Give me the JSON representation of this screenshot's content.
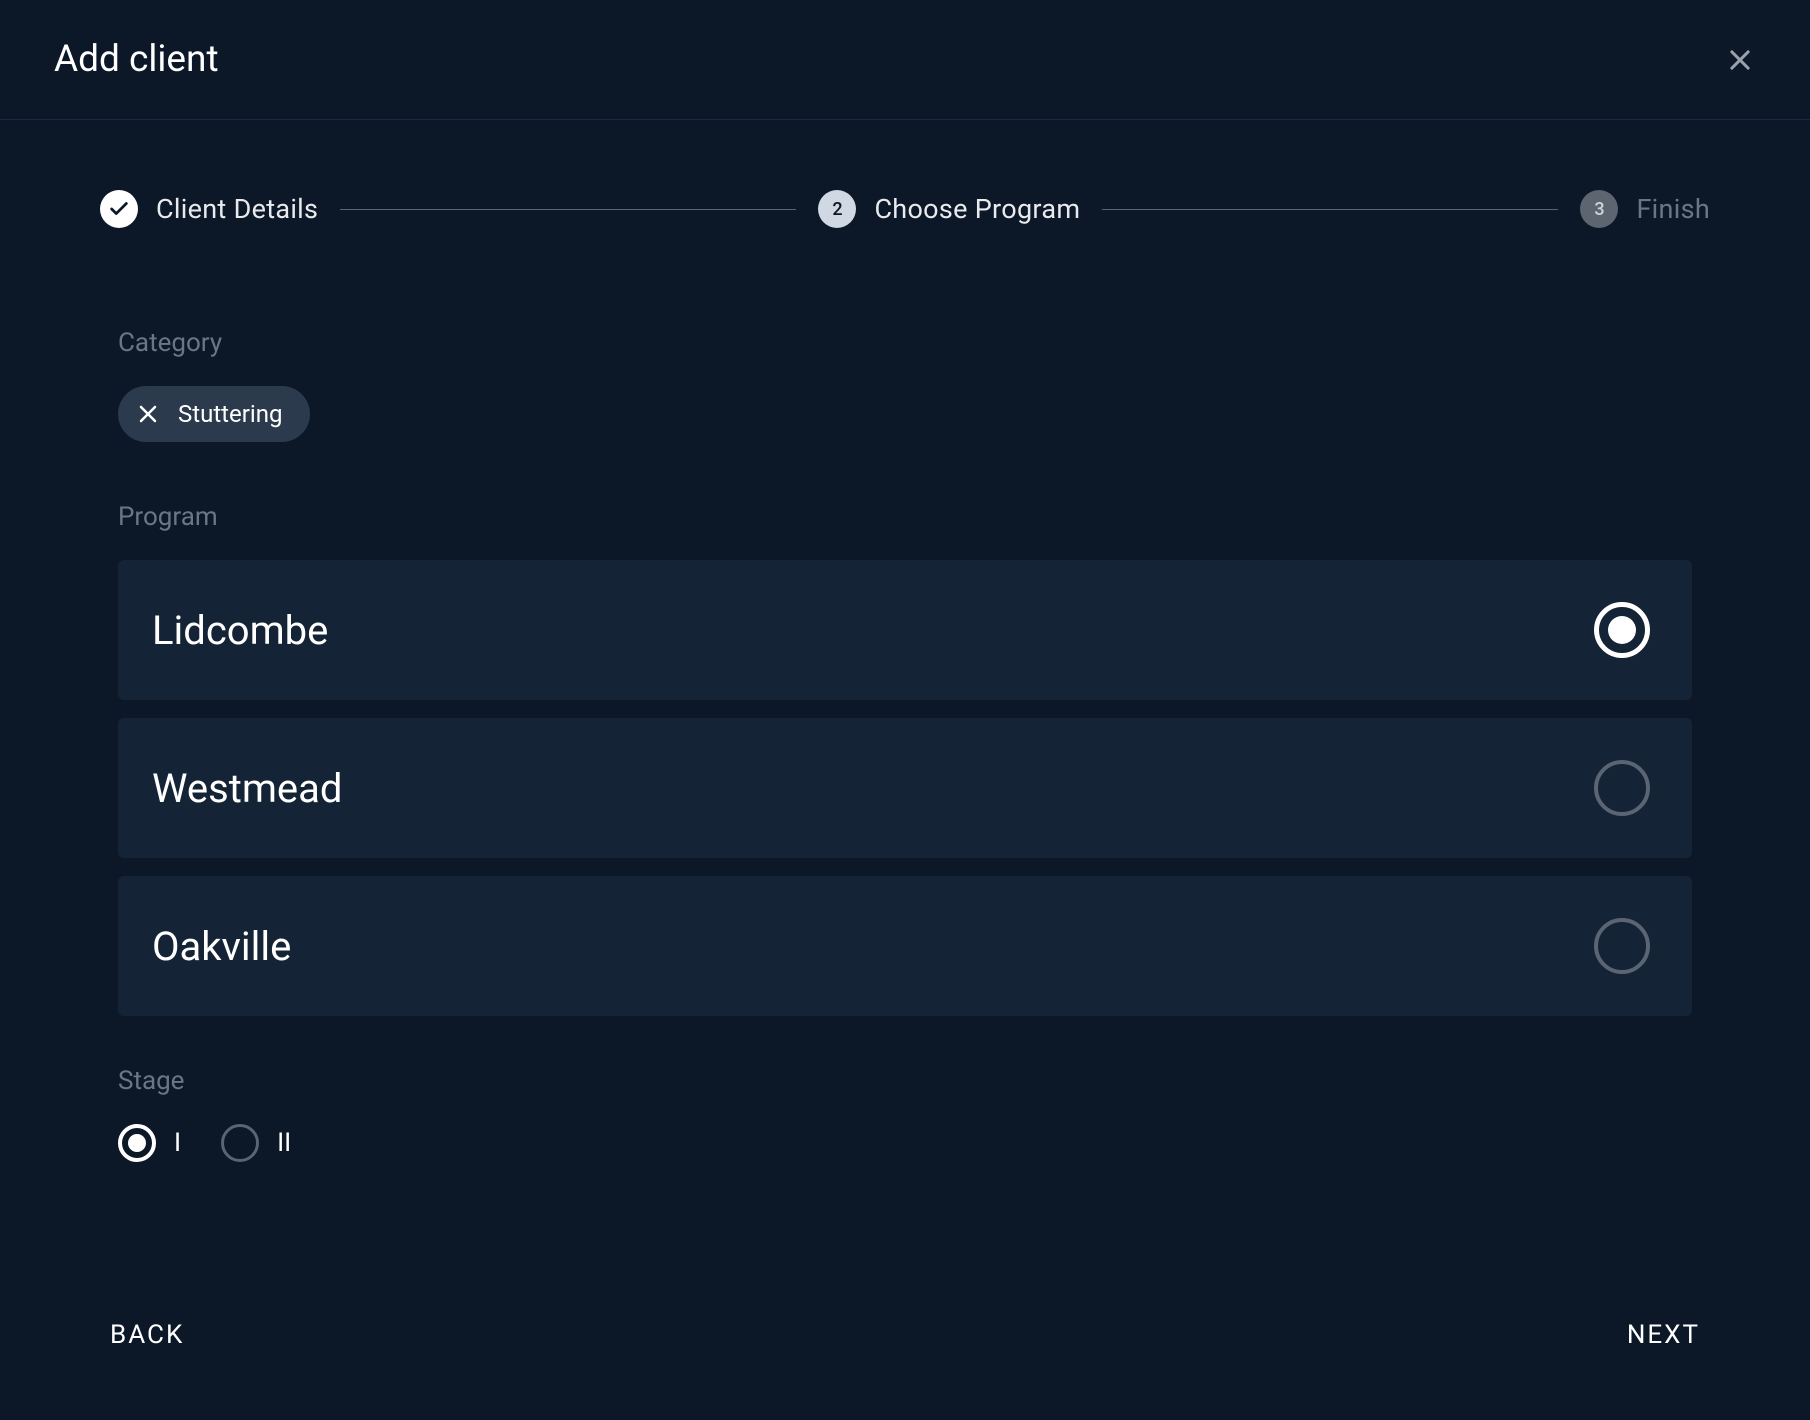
{
  "modal": {
    "title": "Add client"
  },
  "stepper": {
    "steps": [
      {
        "label": "Client Details",
        "state": "completed"
      },
      {
        "label": "Choose Program",
        "state": "active",
        "number": "2"
      },
      {
        "label": "Finish",
        "state": "pending",
        "number": "3"
      }
    ]
  },
  "category": {
    "label": "Category",
    "chip": "Stuttering"
  },
  "program": {
    "label": "Program",
    "items": [
      {
        "name": "Lidcombe",
        "selected": true
      },
      {
        "name": "Westmead",
        "selected": false
      },
      {
        "name": "Oakville",
        "selected": false
      }
    ]
  },
  "stage": {
    "label": "Stage",
    "options": [
      {
        "text": "I",
        "selected": true
      },
      {
        "text": "II",
        "selected": false
      }
    ]
  },
  "footer": {
    "back": "BACK",
    "next": "NEXT"
  }
}
